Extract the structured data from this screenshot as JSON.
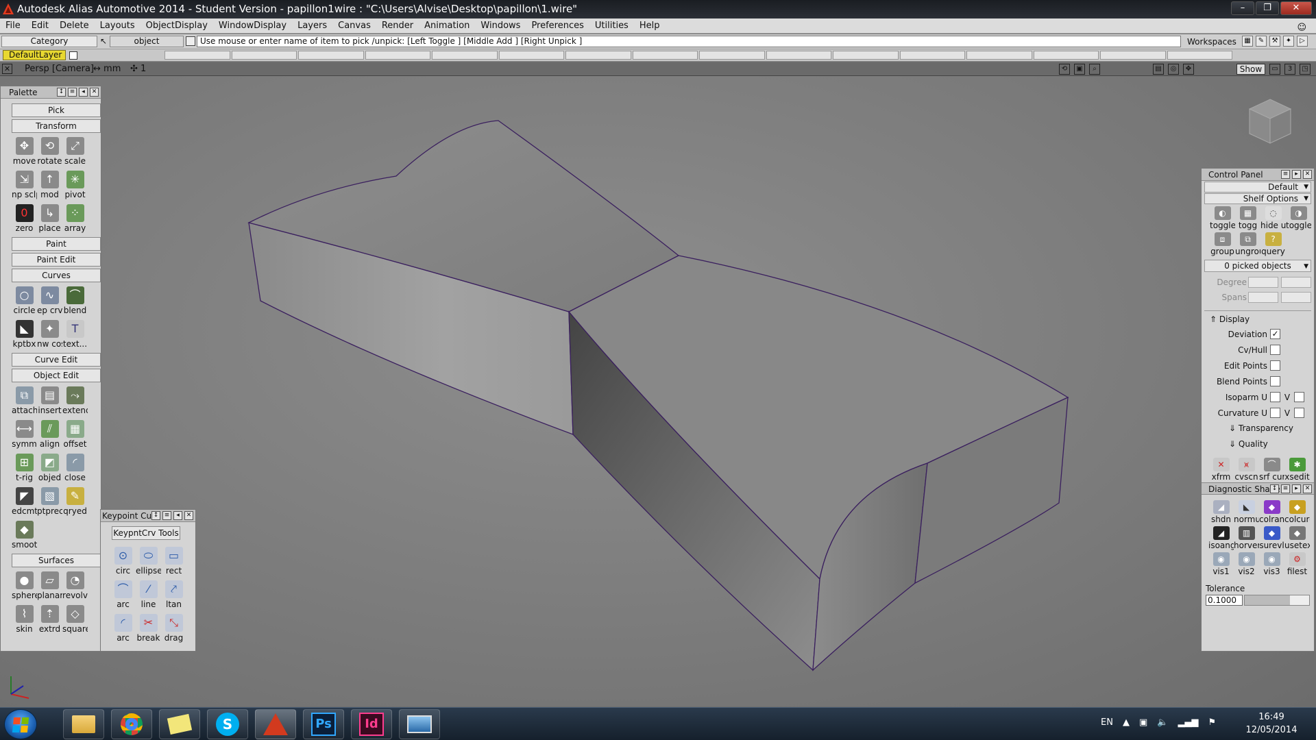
{
  "title": "Autodesk Alias Automotive 2014   - Student Version   - papillon1wire : \"C:\\Users\\Alvise\\Desktop\\papillon\\1.wire\"",
  "menu": [
    "File",
    "Edit",
    "Delete",
    "Layouts",
    "ObjectDisplay",
    "WindowDisplay",
    "Layers",
    "Canvas",
    "Render",
    "Animation",
    "Windows",
    "Preferences",
    "Utilities",
    "Help"
  ],
  "prompt": {
    "category": "Category",
    "object": "object",
    "text": "Use mouse or enter name of item to pick /unpick: [Left Toggle ] [Middle Add ] [Right Unpick ]",
    "workspaces": "Workspaces"
  },
  "layer": {
    "name": "DefaultLayer"
  },
  "view": {
    "camera": "Persp [Camera]",
    "units": "mm",
    "zoom": "1",
    "show": "Show"
  },
  "palette": {
    "title": "Palette",
    "sections": {
      "pick": "Pick",
      "transform": "Transform",
      "paint": "Paint",
      "paint_edit": "Paint Edit",
      "curves": "Curves",
      "curve_edit": "Curve Edit",
      "object_edit": "Object Edit",
      "surfaces": "Surfaces"
    },
    "transform_tools": [
      [
        "move",
        "rotate",
        "scale"
      ],
      [
        "np sclp",
        "mod",
        "pivot"
      ],
      [
        "zero",
        "place",
        "array"
      ]
    ],
    "curve_tools": [
      [
        "circle",
        "ep crv",
        "blend"
      ],
      [
        "kptbx",
        "nw cos",
        "text..."
      ]
    ],
    "object_edit_tools": [
      [
        "attach",
        "insert",
        "extend"
      ],
      [
        "symm",
        "align",
        "offset"
      ],
      [
        "t-rig",
        "objed",
        "close"
      ],
      [
        "edcmt",
        "ptprec",
        "qryed"
      ],
      [
        "smooth"
      ]
    ],
    "surface_tools": [
      [
        "sphere",
        "planar",
        "revolv"
      ],
      [
        "skin",
        "extrd",
        "square"
      ]
    ]
  },
  "keypoint": {
    "title": "Keypoint Cur",
    "tab": "KeypntCrv Tools",
    "tools": [
      [
        "circ",
        "ellipse",
        "rect"
      ],
      [
        "arc",
        "line",
        "ltan"
      ],
      [
        "arc",
        "break",
        "drag"
      ]
    ]
  },
  "control_panel": {
    "title": "Control Panel",
    "preset": "Default",
    "shelf": "Shelf Options",
    "row1": [
      "toggle",
      "togg",
      "hide u",
      "toggle"
    ],
    "row2": [
      "group",
      "ungroup",
      "query"
    ],
    "picked": "0 picked objects",
    "degree": "Degree",
    "spans": "Spans",
    "display": "Display",
    "deviation": "Deviation",
    "cvhull": "Cv/Hull",
    "editpoints": "Edit Points",
    "blendpoints": "Blend Points",
    "isoparm": "Isoparm U",
    "curvature": "Curvature U",
    "v": "V",
    "transparency": "Transparency",
    "quality": "Quality",
    "row3": [
      "xfrm",
      "cvscn",
      "srf curva",
      "xsedit"
    ],
    "diag_title": "Diagnostic Shade",
    "diag_row1": [
      "shdn",
      "normul",
      "colran",
      "colcurev"
    ],
    "diag_row2": [
      "isoang",
      "horver",
      "surevl",
      "usetex"
    ],
    "diag_row3": [
      "vis1",
      "vis2",
      "vis3",
      "filest"
    ],
    "tolerance": "Tolerance",
    "tolerance_value": "0.1000"
  },
  "taskbar": {
    "apps": [
      "explorer",
      "chrome",
      "notes",
      "skype",
      "alias",
      "photoshop",
      "indesign",
      "viewer"
    ],
    "ps": "Ps",
    "id": "Id",
    "skype": "S",
    "lang": "EN",
    "time": "16:49",
    "date": "12/05/2014"
  },
  "colors": {
    "layer": "#e8d830",
    "edge": "#3a1f5e",
    "accent": "#1b5fb0"
  }
}
